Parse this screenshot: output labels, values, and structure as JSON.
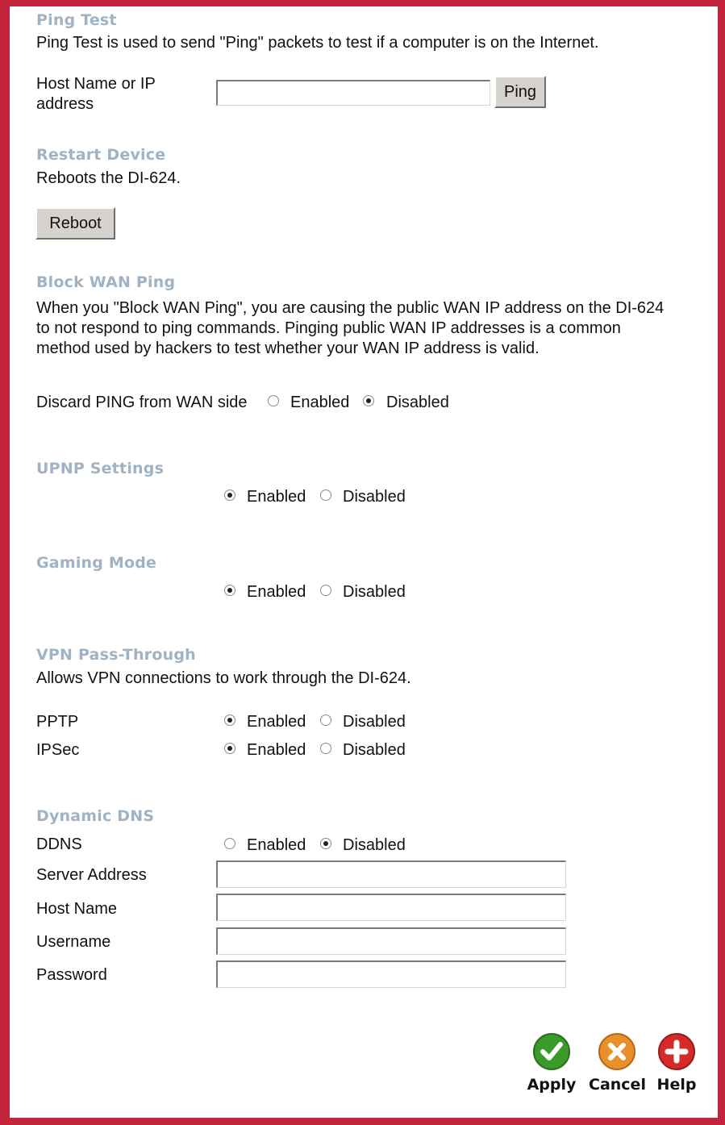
{
  "ping_test": {
    "heading": "Ping Test",
    "description": "Ping Test is used to send \"Ping\" packets to test if a computer is on the Internet.",
    "host_label_line1": "Host Name or IP",
    "host_label_line2": "address",
    "host_value": "",
    "ping_button": "Ping"
  },
  "restart_device": {
    "heading": "Restart Device",
    "description": "Reboots the DI-624.",
    "reboot_button": "Reboot"
  },
  "block_wan_ping": {
    "heading": "Block WAN Ping",
    "desc_line1": "When you \"Block WAN Ping\", you are causing the public WAN IP address on the DI-624",
    "desc_line2": "to not respond to ping commands. Pinging public WAN IP addresses is a common",
    "desc_line3": "method used by hackers to test whether your WAN IP address is valid.",
    "discard_label": "Discard PING from WAN side",
    "selected": "Disabled"
  },
  "upnp": {
    "heading": "UPNP Settings",
    "selected": "Enabled"
  },
  "gaming_mode": {
    "heading": "Gaming Mode",
    "selected": "Enabled"
  },
  "vpn": {
    "heading": "VPN Pass-Through",
    "description": "Allows VPN connections to work through the DI-624.",
    "pptp_label": "PPTP",
    "pptp_selected": "Enabled",
    "ipsec_label": "IPSec",
    "ipsec_selected": "Enabled"
  },
  "ddns": {
    "heading": "Dynamic DNS",
    "ddns_label": "DDNS",
    "selected": "Disabled",
    "server_label": "Server Address",
    "server_value": "",
    "hostname_label": "Host Name",
    "hostname_value": "",
    "username_label": "Username",
    "username_value": "",
    "password_label": "Password",
    "password_value": ""
  },
  "options": {
    "enabled": "Enabled",
    "disabled": "Disabled"
  },
  "actions": {
    "apply": "Apply",
    "cancel": "Cancel",
    "help": "Help"
  },
  "colors": {
    "frame": "#c3243c",
    "heading": "#9fb3c4",
    "apply_icon": "#3a9a2a",
    "cancel_icon": "#e8902a",
    "help_icon": "#d42a2a"
  }
}
